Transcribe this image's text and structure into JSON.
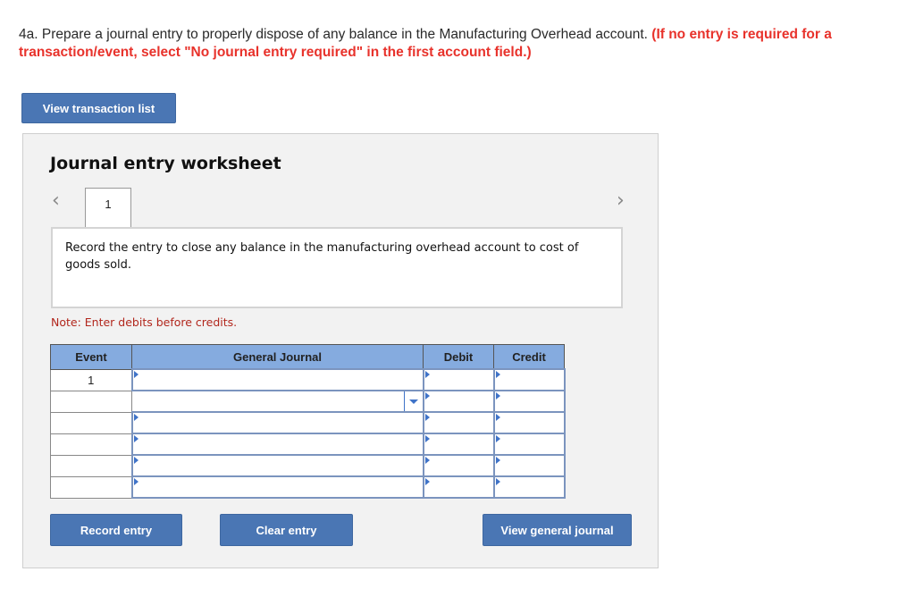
{
  "question": {
    "text": "4a. Prepare a journal entry to properly dispose of any balance in the Manufacturing Overhead account.",
    "instruction": "(If no entry is required for a transaction/event, select \"No journal entry required\" in the first account field.)"
  },
  "buttons": {
    "view_transaction_list": "View transaction list",
    "record_entry": "Record entry",
    "clear_entry": "Clear entry",
    "view_general_journal": "View general journal"
  },
  "worksheet": {
    "title": "Journal entry worksheet",
    "prev_icon": "‹",
    "next_icon": "›",
    "tabs": [
      "1"
    ],
    "description": "Record the entry to close any balance in the manufacturing overhead account to cost of goods sold.",
    "note": "Note: Enter debits before credits.",
    "table": {
      "headers": [
        "Event",
        "General Journal",
        "Debit",
        "Credit"
      ],
      "rows": [
        {
          "event": "1",
          "account": "",
          "debit": "",
          "credit": ""
        },
        {
          "event": "",
          "account": "",
          "debit": "",
          "credit": ""
        },
        {
          "event": "",
          "account": "",
          "debit": "",
          "credit": ""
        },
        {
          "event": "",
          "account": "",
          "debit": "",
          "credit": ""
        },
        {
          "event": "",
          "account": "",
          "debit": "",
          "credit": ""
        },
        {
          "event": "",
          "account": "",
          "debit": "",
          "credit": ""
        }
      ]
    }
  },
  "colors": {
    "button": "#4a76b4",
    "header": "#85abdf",
    "instruction_red": "#e8322b",
    "note_red": "#b2271d"
  }
}
